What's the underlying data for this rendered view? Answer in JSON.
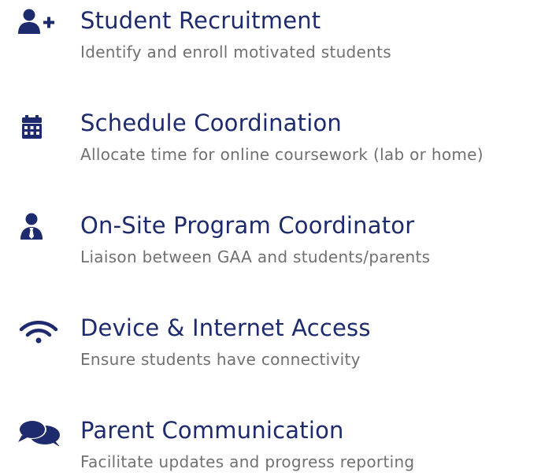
{
  "colors": {
    "title": "#1d2a6d",
    "icon": "#1d2a6d",
    "description": "#707070"
  },
  "items": [
    {
      "icon": "user-plus-icon",
      "title": "Student Recruitment",
      "description": "Identify and enroll motivated students"
    },
    {
      "icon": "calendar-icon",
      "title": "Schedule Coordination",
      "description": "Allocate time for online coursework (lab or home)"
    },
    {
      "icon": "user-tie-icon",
      "title": "On-Site Program Coordinator",
      "description": "Liaison between GAA and students/parents"
    },
    {
      "icon": "wifi-icon",
      "title": "Device & Internet Access",
      "description": "Ensure students have connectivity"
    },
    {
      "icon": "comments-icon",
      "title": "Parent Communication",
      "description": "Facilitate updates and progress reporting"
    }
  ]
}
